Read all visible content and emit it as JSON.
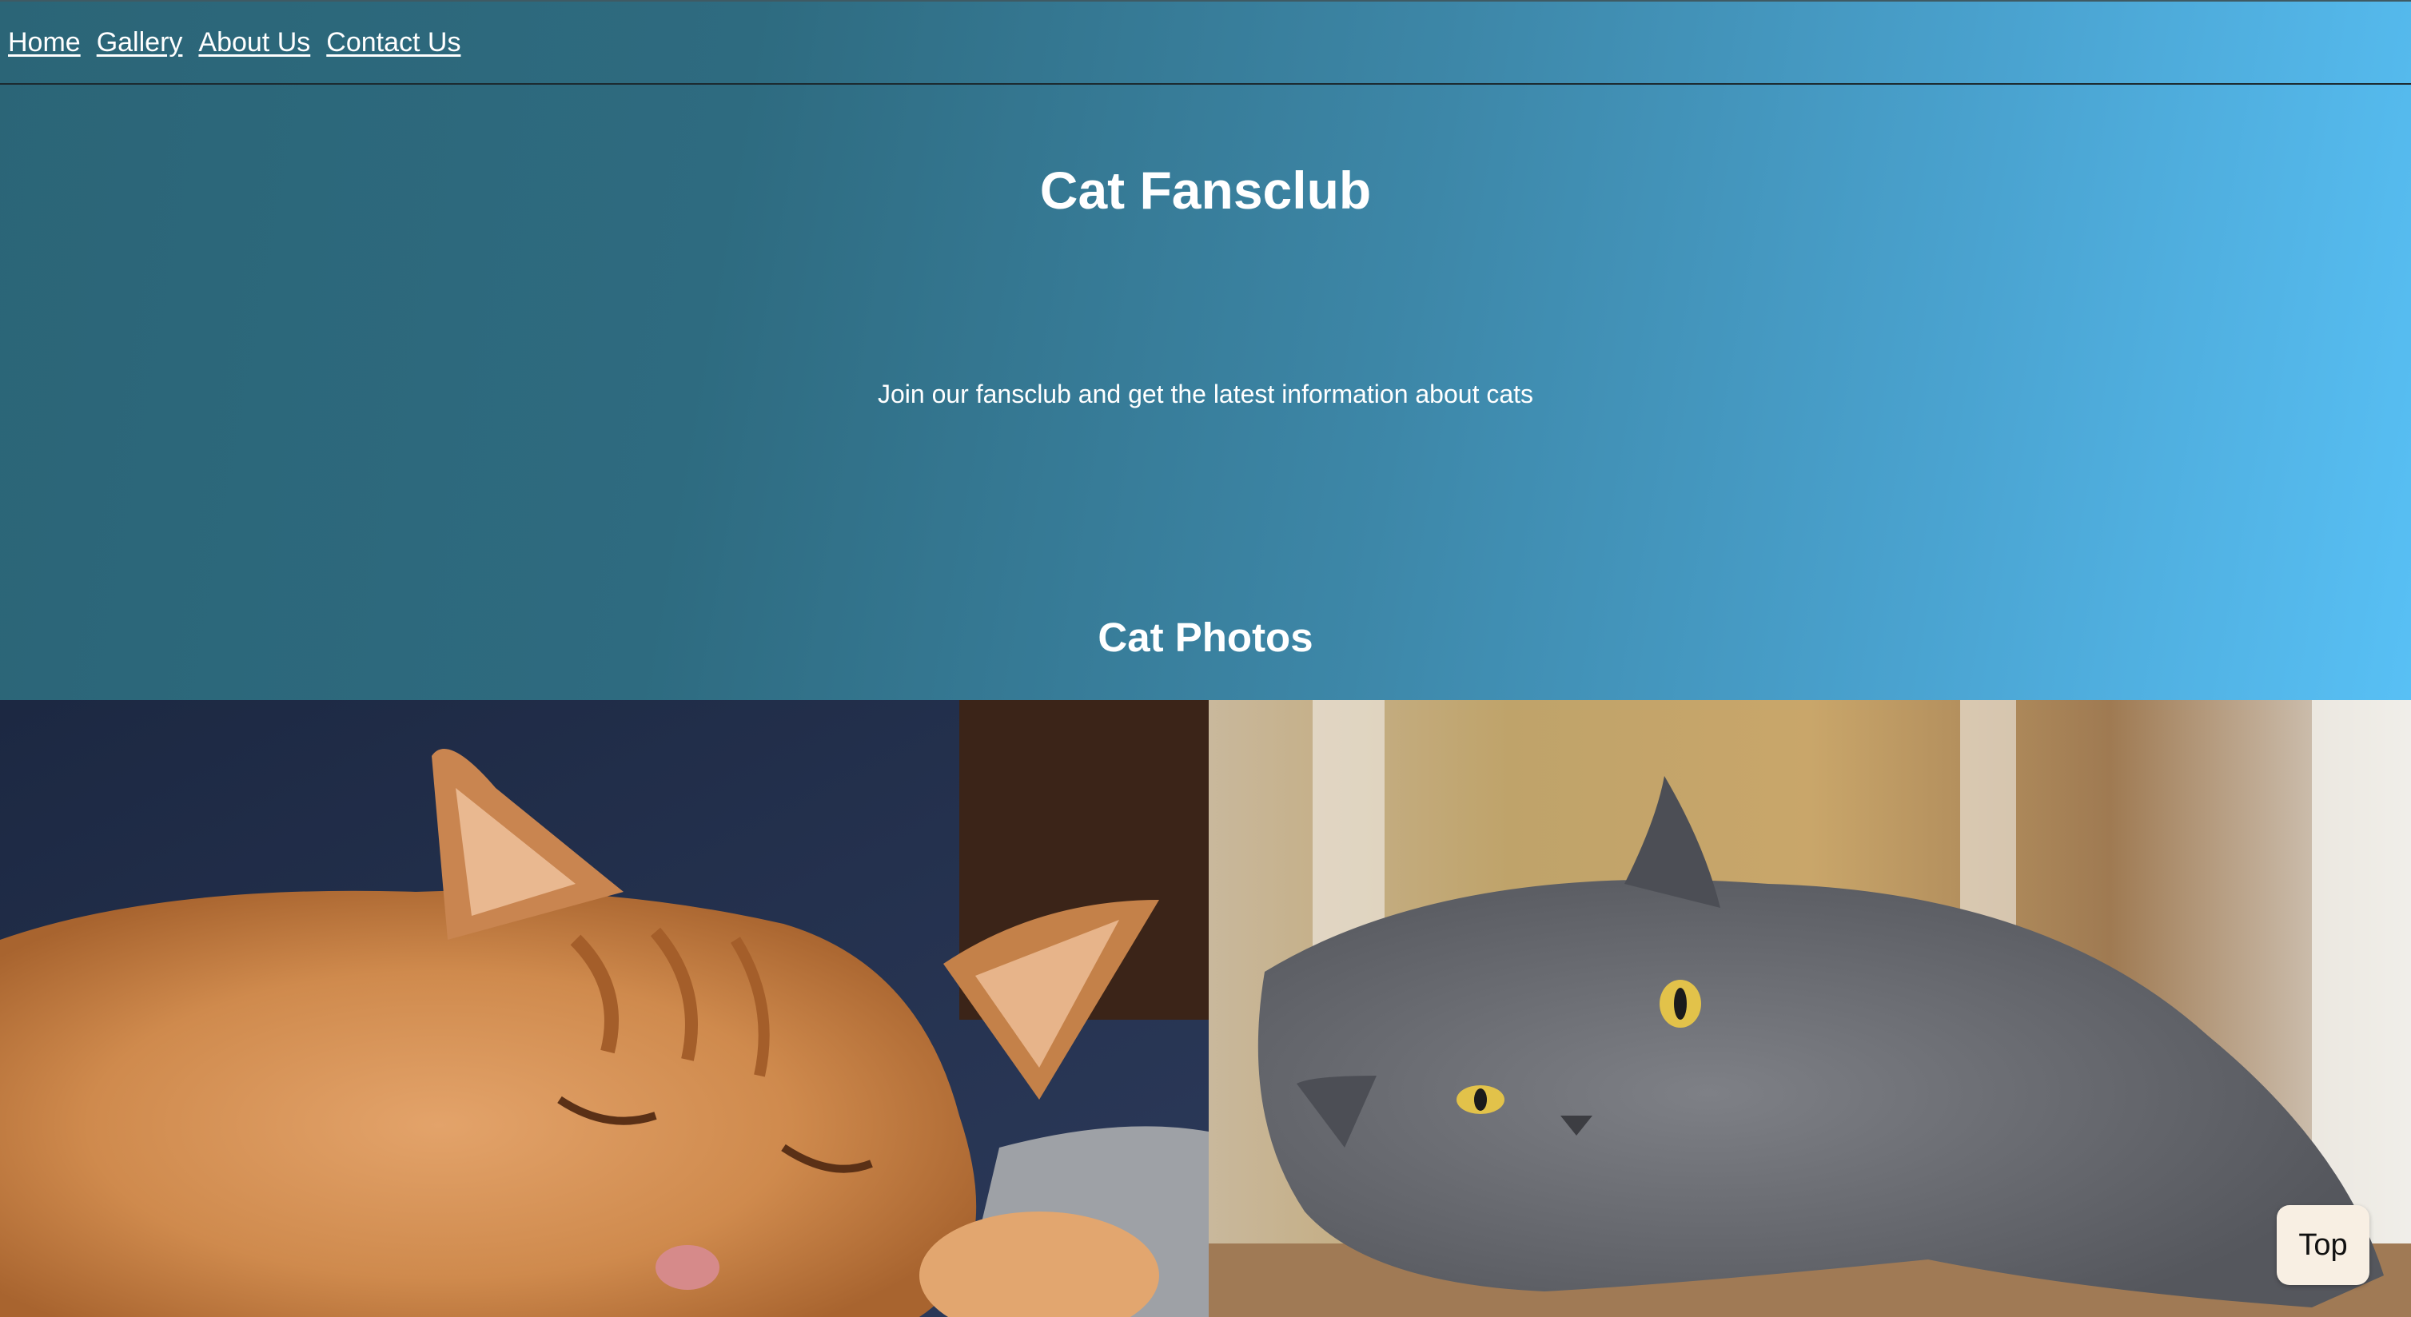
{
  "nav": {
    "links": [
      {
        "label": "Home"
      },
      {
        "label": "Gallery"
      },
      {
        "label": "About Us"
      },
      {
        "label": "Contact Us"
      }
    ]
  },
  "hero": {
    "title": "Cat Fansclub",
    "subtitle": "Join our fansclub and get the latest information about cats"
  },
  "gallery": {
    "heading": "Cat Photos",
    "photos": [
      {
        "subject": "orange tabby cat sleeping"
      },
      {
        "subject": "grey British Shorthair cat lying on floor"
      }
    ]
  },
  "top_button": {
    "label": "Top"
  },
  "colors": {
    "gradient_start": "#2b6577",
    "gradient_end": "#58c0f5",
    "text": "#ffffff",
    "top_button_bg": "#f8efe3"
  }
}
